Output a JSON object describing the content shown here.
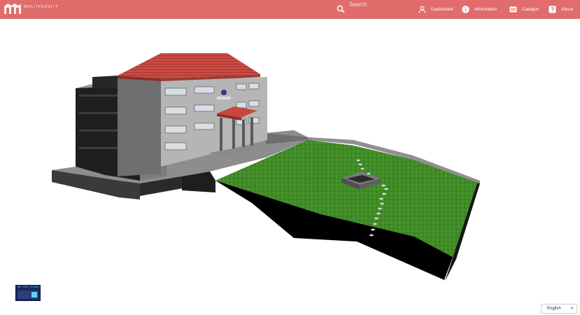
{
  "header": {
    "brand_text": "MULTIVERSITY",
    "search_placeholder": "Search",
    "nav": [
      {
        "label": "Dashboard",
        "icon": "user-icon"
      },
      {
        "label": "Information",
        "icon": "info-icon"
      },
      {
        "label": "Categori",
        "icon": "category-icon"
      },
      {
        "label": "About",
        "icon": "help-icon"
      }
    ]
  },
  "stats": {
    "label": "60 FPS (0-60)"
  },
  "language": {
    "selected": "English"
  },
  "colors": {
    "header": "#e06c6c",
    "roof": "#c94a43",
    "grass": "#3f8a26",
    "stats_bg": "#18285a"
  }
}
